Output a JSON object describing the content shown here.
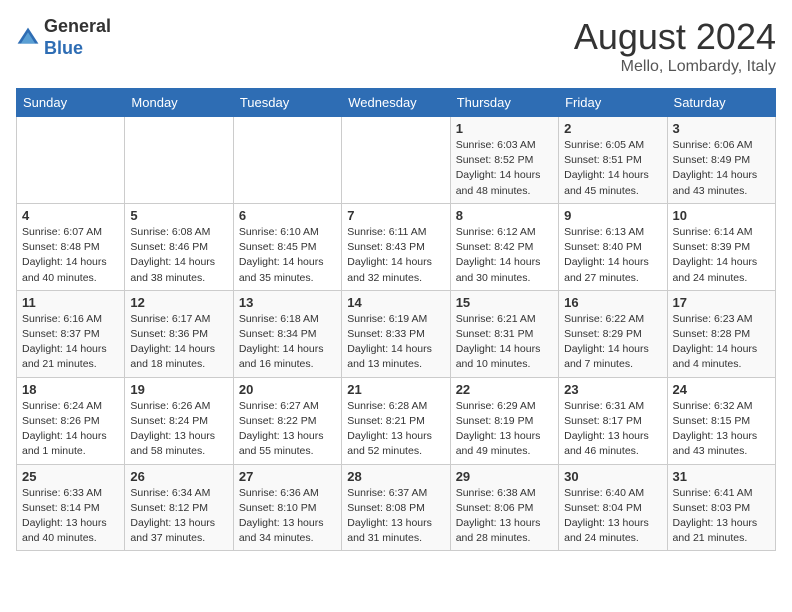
{
  "header": {
    "logo_general": "General",
    "logo_blue": "Blue",
    "title": "August 2024",
    "subtitle": "Mello, Lombardy, Italy"
  },
  "days_of_week": [
    "Sunday",
    "Monday",
    "Tuesday",
    "Wednesday",
    "Thursday",
    "Friday",
    "Saturday"
  ],
  "weeks": [
    [
      {
        "day": "",
        "info": ""
      },
      {
        "day": "",
        "info": ""
      },
      {
        "day": "",
        "info": ""
      },
      {
        "day": "",
        "info": ""
      },
      {
        "day": "1",
        "info": "Sunrise: 6:03 AM\nSunset: 8:52 PM\nDaylight: 14 hours and 48 minutes."
      },
      {
        "day": "2",
        "info": "Sunrise: 6:05 AM\nSunset: 8:51 PM\nDaylight: 14 hours and 45 minutes."
      },
      {
        "day": "3",
        "info": "Sunrise: 6:06 AM\nSunset: 8:49 PM\nDaylight: 14 hours and 43 minutes."
      }
    ],
    [
      {
        "day": "4",
        "info": "Sunrise: 6:07 AM\nSunset: 8:48 PM\nDaylight: 14 hours and 40 minutes."
      },
      {
        "day": "5",
        "info": "Sunrise: 6:08 AM\nSunset: 8:46 PM\nDaylight: 14 hours and 38 minutes."
      },
      {
        "day": "6",
        "info": "Sunrise: 6:10 AM\nSunset: 8:45 PM\nDaylight: 14 hours and 35 minutes."
      },
      {
        "day": "7",
        "info": "Sunrise: 6:11 AM\nSunset: 8:43 PM\nDaylight: 14 hours and 32 minutes."
      },
      {
        "day": "8",
        "info": "Sunrise: 6:12 AM\nSunset: 8:42 PM\nDaylight: 14 hours and 30 minutes."
      },
      {
        "day": "9",
        "info": "Sunrise: 6:13 AM\nSunset: 8:40 PM\nDaylight: 14 hours and 27 minutes."
      },
      {
        "day": "10",
        "info": "Sunrise: 6:14 AM\nSunset: 8:39 PM\nDaylight: 14 hours and 24 minutes."
      }
    ],
    [
      {
        "day": "11",
        "info": "Sunrise: 6:16 AM\nSunset: 8:37 PM\nDaylight: 14 hours and 21 minutes."
      },
      {
        "day": "12",
        "info": "Sunrise: 6:17 AM\nSunset: 8:36 PM\nDaylight: 14 hours and 18 minutes."
      },
      {
        "day": "13",
        "info": "Sunrise: 6:18 AM\nSunset: 8:34 PM\nDaylight: 14 hours and 16 minutes."
      },
      {
        "day": "14",
        "info": "Sunrise: 6:19 AM\nSunset: 8:33 PM\nDaylight: 14 hours and 13 minutes."
      },
      {
        "day": "15",
        "info": "Sunrise: 6:21 AM\nSunset: 8:31 PM\nDaylight: 14 hours and 10 minutes."
      },
      {
        "day": "16",
        "info": "Sunrise: 6:22 AM\nSunset: 8:29 PM\nDaylight: 14 hours and 7 minutes."
      },
      {
        "day": "17",
        "info": "Sunrise: 6:23 AM\nSunset: 8:28 PM\nDaylight: 14 hours and 4 minutes."
      }
    ],
    [
      {
        "day": "18",
        "info": "Sunrise: 6:24 AM\nSunset: 8:26 PM\nDaylight: 14 hours and 1 minute."
      },
      {
        "day": "19",
        "info": "Sunrise: 6:26 AM\nSunset: 8:24 PM\nDaylight: 13 hours and 58 minutes."
      },
      {
        "day": "20",
        "info": "Sunrise: 6:27 AM\nSunset: 8:22 PM\nDaylight: 13 hours and 55 minutes."
      },
      {
        "day": "21",
        "info": "Sunrise: 6:28 AM\nSunset: 8:21 PM\nDaylight: 13 hours and 52 minutes."
      },
      {
        "day": "22",
        "info": "Sunrise: 6:29 AM\nSunset: 8:19 PM\nDaylight: 13 hours and 49 minutes."
      },
      {
        "day": "23",
        "info": "Sunrise: 6:31 AM\nSunset: 8:17 PM\nDaylight: 13 hours and 46 minutes."
      },
      {
        "day": "24",
        "info": "Sunrise: 6:32 AM\nSunset: 8:15 PM\nDaylight: 13 hours and 43 minutes."
      }
    ],
    [
      {
        "day": "25",
        "info": "Sunrise: 6:33 AM\nSunset: 8:14 PM\nDaylight: 13 hours and 40 minutes."
      },
      {
        "day": "26",
        "info": "Sunrise: 6:34 AM\nSunset: 8:12 PM\nDaylight: 13 hours and 37 minutes."
      },
      {
        "day": "27",
        "info": "Sunrise: 6:36 AM\nSunset: 8:10 PM\nDaylight: 13 hours and 34 minutes."
      },
      {
        "day": "28",
        "info": "Sunrise: 6:37 AM\nSunset: 8:08 PM\nDaylight: 13 hours and 31 minutes."
      },
      {
        "day": "29",
        "info": "Sunrise: 6:38 AM\nSunset: 8:06 PM\nDaylight: 13 hours and 28 minutes."
      },
      {
        "day": "30",
        "info": "Sunrise: 6:40 AM\nSunset: 8:04 PM\nDaylight: 13 hours and 24 minutes."
      },
      {
        "day": "31",
        "info": "Sunrise: 6:41 AM\nSunset: 8:03 PM\nDaylight: 13 hours and 21 minutes."
      }
    ]
  ]
}
